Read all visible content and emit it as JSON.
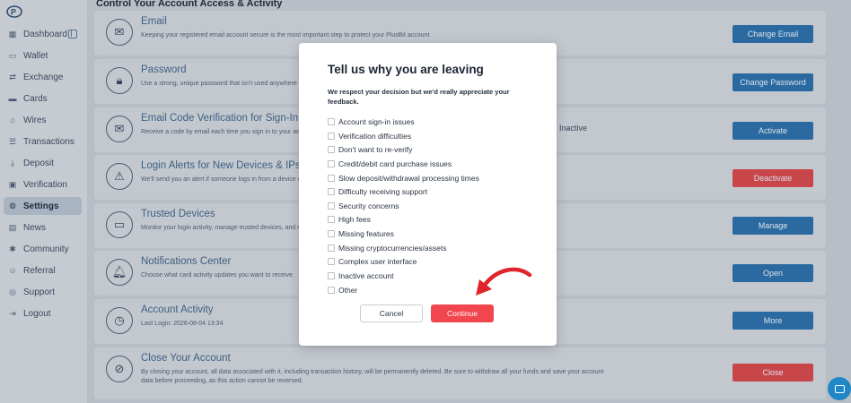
{
  "sidebar": {
    "items": [
      {
        "label": "Dashboard",
        "icon": "dashboard-icon"
      },
      {
        "label": "Wallet",
        "icon": "wallet-icon"
      },
      {
        "label": "Exchange",
        "icon": "exchange-icon"
      },
      {
        "label": "Cards",
        "icon": "card-icon"
      },
      {
        "label": "Wires",
        "icon": "wire-icon"
      },
      {
        "label": "Transactions",
        "icon": "list-icon"
      },
      {
        "label": "Deposit",
        "icon": "deposit-icon"
      },
      {
        "label": "Verification",
        "icon": "verification-icon"
      },
      {
        "label": "Settings",
        "icon": "gear-icon"
      },
      {
        "label": "News",
        "icon": "news-icon"
      },
      {
        "label": "Community",
        "icon": "community-icon"
      },
      {
        "label": "Referral",
        "icon": "referral-icon"
      },
      {
        "label": "Support",
        "icon": "support-icon"
      },
      {
        "label": "Logout",
        "icon": "logout-icon"
      }
    ],
    "active_label": "Settings"
  },
  "main": {
    "title": "Control Your Account Access & Activity",
    "cards": [
      {
        "title": "Email",
        "desc": "Keeping your registered email account secure is the most important step to protect your PlusBit account",
        "status": "",
        "button": "Change Email",
        "button_color": "blue"
      },
      {
        "title": "Password",
        "desc": "Use a strong, unique password that isn't used anywhere e",
        "status": "",
        "button": "Change Password",
        "button_color": "blue"
      },
      {
        "title": "Email Code Verification for Sign-In",
        "desc": "Receive a code by email each time you sign in to your acc",
        "status": "Inactive",
        "button": "Activate",
        "button_color": "blue"
      },
      {
        "title": "Login Alerts for New Devices & IPs",
        "desc": "We'll send you an alert if someone logs in from a device o",
        "status": "",
        "button": "Deactivate",
        "button_color": "red"
      },
      {
        "title": "Trusted Devices",
        "desc": "Monitor your login activity, manage trusted devices, and r",
        "status": "",
        "button": "Manage",
        "button_color": "blue"
      },
      {
        "title": "Notifications Center",
        "desc": "Choose what card activity updates you want to receive.",
        "status": "",
        "button": "Open",
        "button_color": "blue"
      },
      {
        "title": "Account Activity",
        "desc": "Last Login: 2026-08-04 13:34",
        "status": "",
        "button": "More",
        "button_color": "blue"
      },
      {
        "title": "Close Your Account",
        "desc": "By closing your account, all data associated with it, including transaction history, will be permanently deleted. Be sure to withdraw all your funds and save your account data before proceeding, as this action cannot be reversed.",
        "status": "",
        "button": "Close",
        "button_color": "red"
      }
    ]
  },
  "modal": {
    "title": "Tell us why you are leaving",
    "subtitle": "We respect your decision but we'd really appreciate your feedback.",
    "options": [
      "Account sign-in issues",
      "Verification difficulties",
      "Don't want to re-verify",
      "Credit/debit card purchase issues",
      "Slow deposit/withdrawal processing times",
      "Difficulty receiving support",
      "Security concerns",
      "High fees",
      "Missing features",
      "Missing cryptocurrencies/assets",
      "Complex user interface",
      "Inactive account",
      "Other"
    ],
    "cancel_label": "Cancel",
    "continue_label": "Continue"
  },
  "colors": {
    "accent_blue": "#2b6aa0",
    "danger_red": "#c8454a",
    "continue_red": "#f1464e",
    "arrow_red": "#e0242b"
  }
}
